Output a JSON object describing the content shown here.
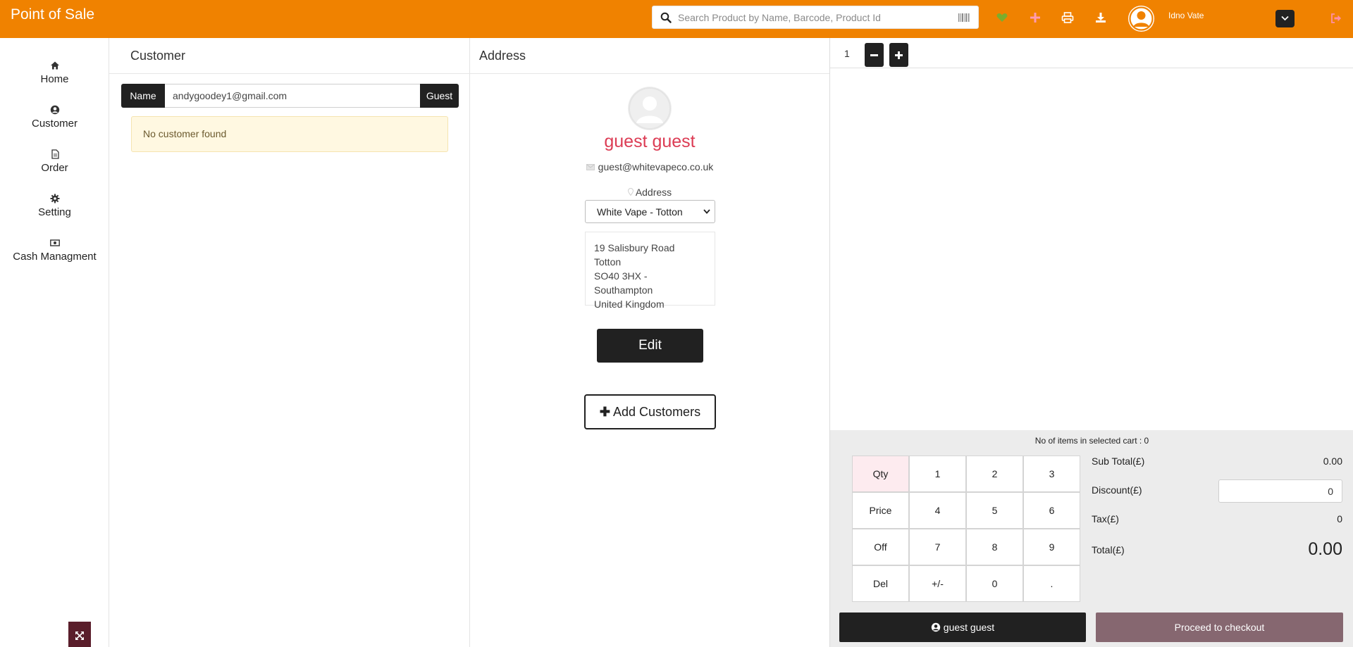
{
  "header": {
    "brand": "Point of Sale",
    "search_placeholder": "Search Product by Name, Barcode, Product Id",
    "user_name": "Idno Vate",
    "colors": {
      "bar": "#f08200"
    }
  },
  "sidebar": {
    "items": [
      {
        "label": "Home",
        "icon": "home-icon"
      },
      {
        "label": "Customer",
        "icon": "user-circle-icon"
      },
      {
        "label": "Order",
        "icon": "document-icon"
      },
      {
        "label": "Setting",
        "icon": "gear-icon"
      },
      {
        "label": "Cash Managment",
        "icon": "cash-icon"
      }
    ]
  },
  "customer": {
    "title": "Customer",
    "name_label": "Name",
    "name_value": "andygoodey1@gmail.com",
    "guest_button": "Guest",
    "alert": "No customer found"
  },
  "address": {
    "title": "Address",
    "customer_name": "guest guest",
    "email": "guest@whitevapeco.co.uk",
    "address_label": "Address",
    "selected_store": "White Vape - Totton",
    "lines": [
      "19 Salisbury Road",
      "Totton",
      "SO40 3HX - Southampton",
      "United Kingdom"
    ],
    "edit_button": "Edit",
    "add_button": "Add Customers"
  },
  "cart": {
    "qty_value": "1",
    "items_line": "No of items in selected cart : 0",
    "keypad": [
      "Qty",
      "1",
      "2",
      "3",
      "Price",
      "4",
      "5",
      "6",
      "Off",
      "7",
      "8",
      "9",
      "Del",
      "+/-",
      "0",
      "."
    ],
    "subtotal_label": "Sub Total(£)",
    "subtotal_value": "0.00",
    "discount_label": "Discount(£)",
    "discount_value": "0",
    "tax_label": "Tax(£)",
    "tax_value": "0",
    "total_label": "Total(£)",
    "total_value": "0.00",
    "customer_button": "guest guest",
    "checkout_button": "Proceed to checkout"
  }
}
